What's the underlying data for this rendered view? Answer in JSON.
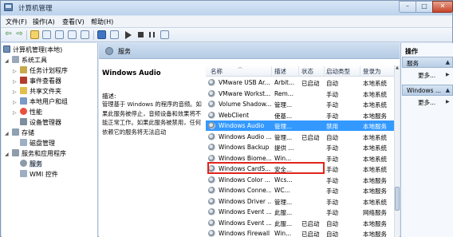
{
  "window": {
    "title": "计算机管理"
  },
  "menubar": {
    "items": [
      "文件(F)",
      "操作(A)",
      "查看(V)",
      "帮助(H)"
    ]
  },
  "tree": {
    "root": "计算机管理(本地)",
    "system_tools": "系统工具",
    "task_scheduler": "任务计划程序",
    "event_viewer": "事件查看器",
    "shared_folders": "共享文件夹",
    "local_users": "本地用户和组",
    "performance": "性能",
    "device_manager": "设备管理器",
    "storage": "存储",
    "disk_management": "磁盘管理",
    "services_apps": "服务和应用程序",
    "services": "服务",
    "wmi": "WMI 控件"
  },
  "main": {
    "header_title": "服务",
    "selected_service": "Windows Audio",
    "desc_label": "描述:",
    "description": "管理基于 Windows 的程序的音频。如果此服务被停止，音频设备和效果将不能正常工作。如果此服务被禁用，任何依赖它的服务将无法启动"
  },
  "list": {
    "columns": [
      "名称",
      "描述",
      "状态",
      "启动类型",
      "登录为"
    ],
    "rows": [
      {
        "name": "VMware USB Ar...",
        "desc": "Arbit...",
        "status": "已启动",
        "startup": "自动",
        "logon": "本地系统"
      },
      {
        "name": "VMware Workst...",
        "desc": "Rem...",
        "status": "",
        "startup": "手动",
        "logon": "本地系统"
      },
      {
        "name": "Volume Shadow...",
        "desc": "管理...",
        "status": "",
        "startup": "手动",
        "logon": "本地系统"
      },
      {
        "name": "WebClient",
        "desc": "使基...",
        "status": "",
        "startup": "手动",
        "logon": "本地服务"
      },
      {
        "name": "Windows Audio",
        "desc": "管理...",
        "status": "",
        "startup": "禁用",
        "logon": "本地服务"
      },
      {
        "name": "Windows Audio ...",
        "desc": "管理...",
        "status": "已启动",
        "startup": "自动",
        "logon": "本地系统"
      },
      {
        "name": "Windows Backup",
        "desc": "提供 ...",
        "status": "",
        "startup": "手动",
        "logon": "本地系统"
      },
      {
        "name": "Windows Biome...",
        "desc": "Win...",
        "status": "",
        "startup": "手动",
        "logon": "本地系统"
      },
      {
        "name": "Windows CardS...",
        "desc": "安全...",
        "status": "",
        "startup": "手动",
        "logon": "本地系统"
      },
      {
        "name": "Windows Color ...",
        "desc": "Wcs...",
        "status": "",
        "startup": "手动",
        "logon": "本地服务"
      },
      {
        "name": "Windows Conne...",
        "desc": "WC...",
        "status": "",
        "startup": "手动",
        "logon": "本地服务"
      },
      {
        "name": "Windows Driver ...",
        "desc": "管理...",
        "status": "",
        "startup": "手动",
        "logon": "本地系统"
      },
      {
        "name": "Windows Event ...",
        "desc": "此服...",
        "status": "",
        "startup": "手动",
        "logon": "网络服务"
      },
      {
        "name": "Windows Event ...",
        "desc": "此服...",
        "status": "已启动",
        "startup": "自动",
        "logon": "本地服务"
      },
      {
        "name": "Windows Firewall",
        "desc": "Win...",
        "status": "已启动",
        "startup": "自动",
        "logon": "本地服务"
      }
    ],
    "selected_index": 4
  },
  "actions": {
    "title": "操作",
    "group1": "服务",
    "more1": "更多...",
    "group2": "Windows ...",
    "more2": "更多..."
  },
  "colors": {
    "selection": "#3399ff",
    "highlight_border": "#e0241b",
    "header": "#b5cbe4"
  }
}
